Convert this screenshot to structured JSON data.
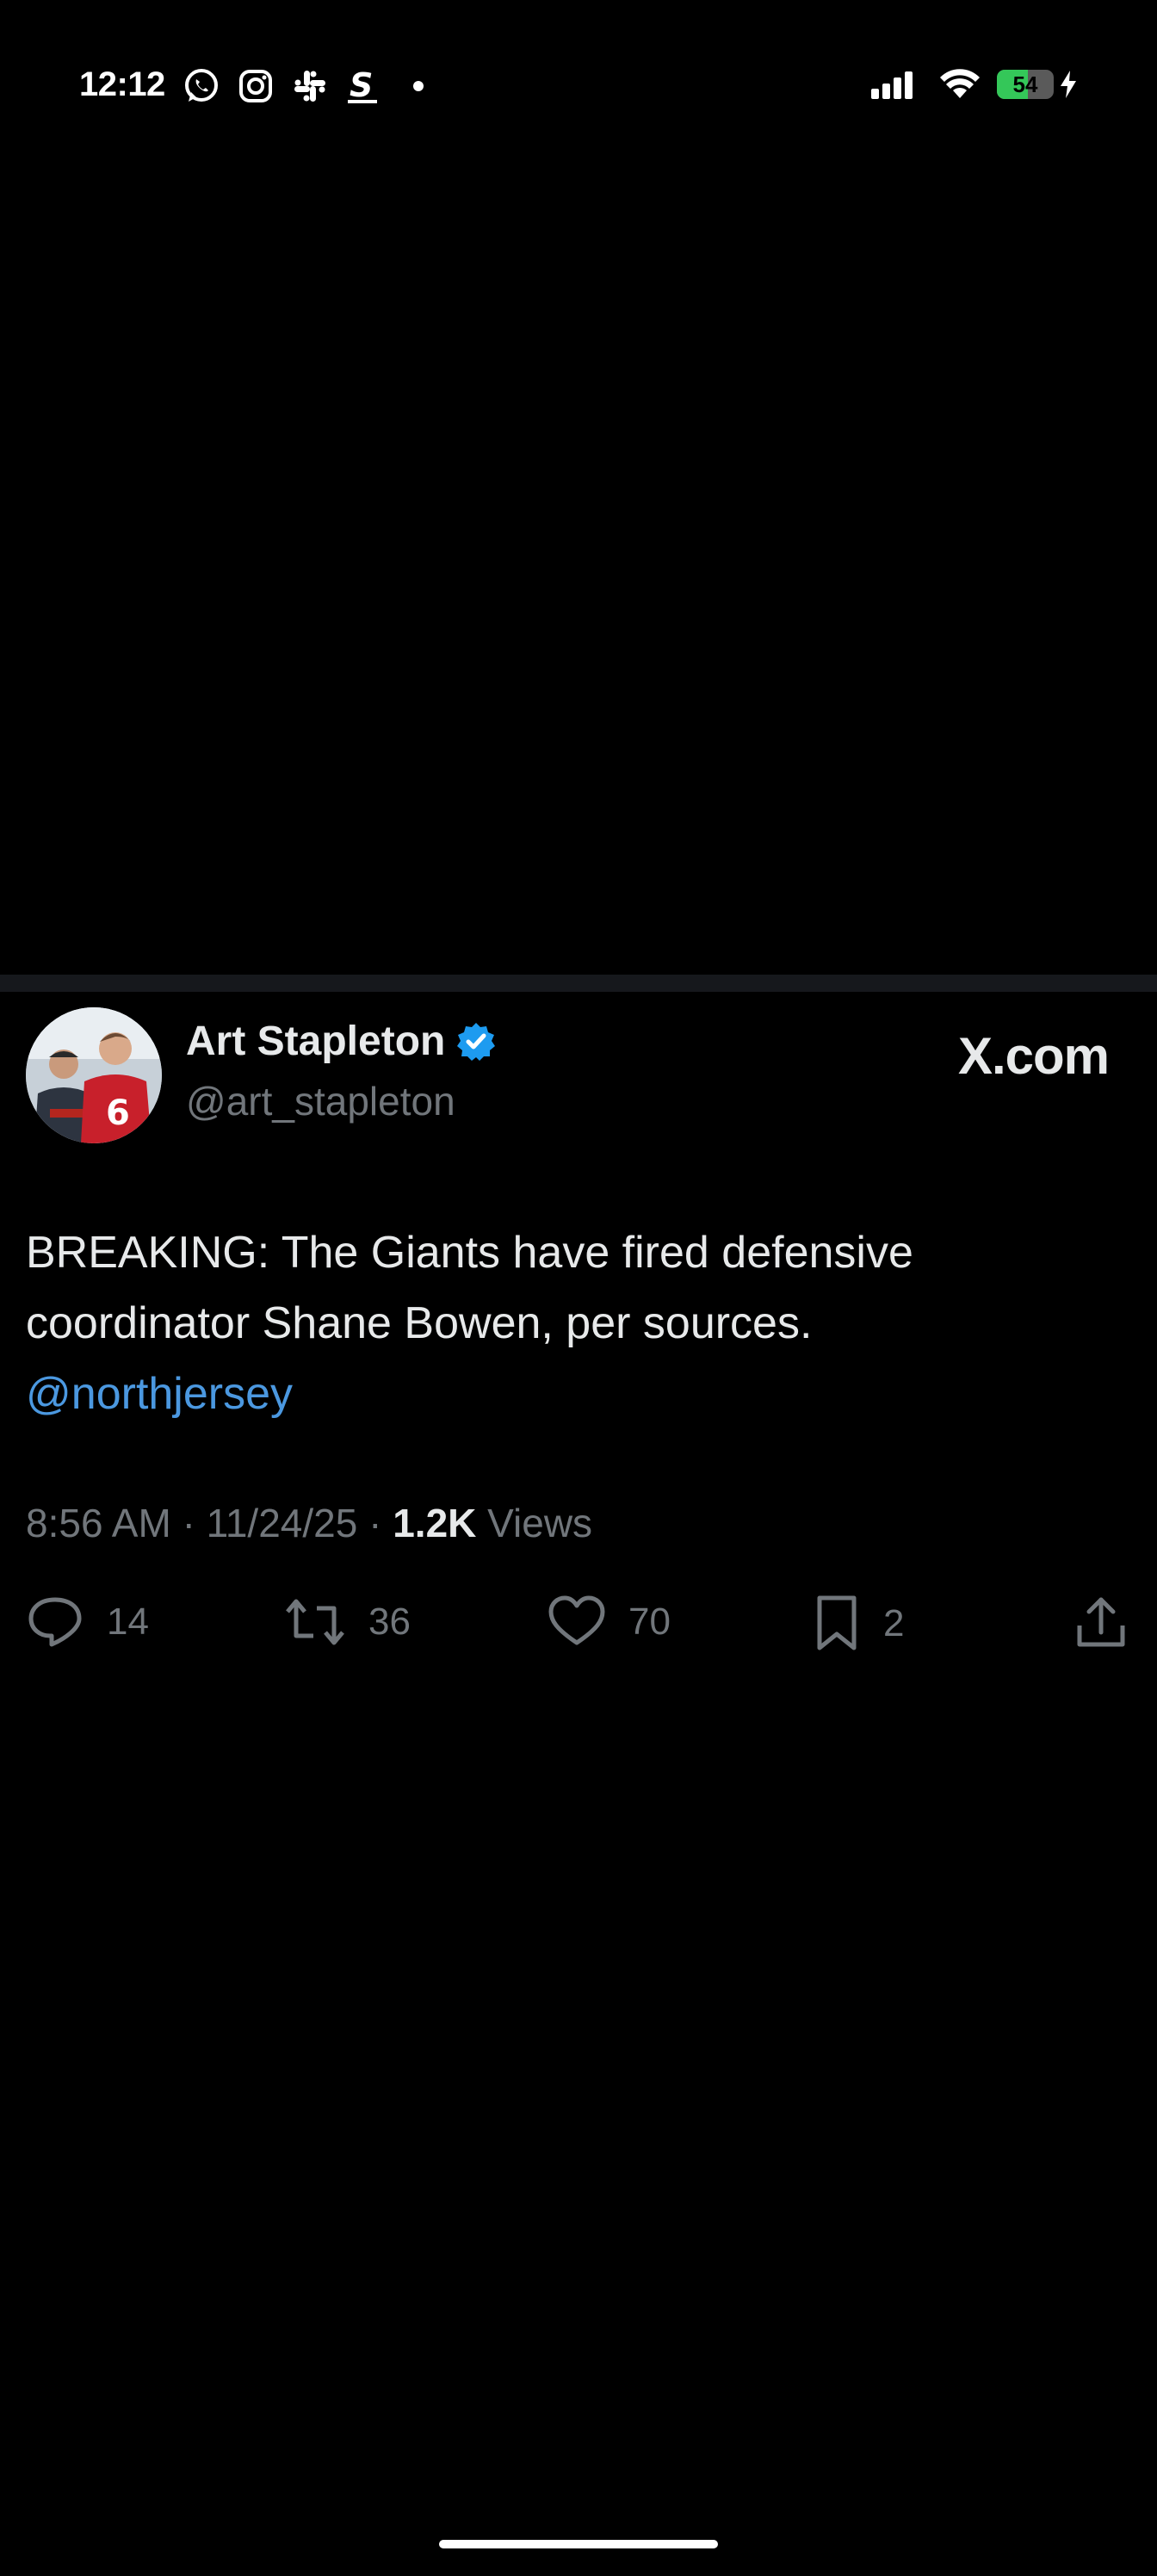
{
  "status_bar": {
    "time": "12:12",
    "battery_level": "54",
    "battery_fraction": 0.54,
    "notification_icons": [
      "whatsapp-icon",
      "instagram-icon",
      "slack-icon",
      "shazam-like-icon",
      "dot-indicator"
    ],
    "system_icons": [
      "cellular-signal-icon",
      "wifi-icon",
      "battery-icon",
      "charging-bolt-icon"
    ]
  },
  "tweet": {
    "author_name": "Art Stapleton",
    "author_handle": "@art_stapleton",
    "verified": true,
    "source_logo": "X.com",
    "text_line1": "BREAKING: The Giants have fired defensive",
    "text_line2": "coordinator Shane Bowen, per sources.",
    "mention": "@northjersey",
    "time": "8:56 AM",
    "date": "11/24/25",
    "views_count": "1.2K",
    "views_label": "Views",
    "separator": "·",
    "replies": "14",
    "reposts": "36",
    "likes": "70",
    "bookmarks": "2"
  },
  "colors": {
    "background": "#000000",
    "text_primary": "#e7e9ea",
    "text_secondary": "#71767b",
    "link": "#4b98e0",
    "verified_badge": "#1d9bf0",
    "battery_green": "#34c759"
  }
}
